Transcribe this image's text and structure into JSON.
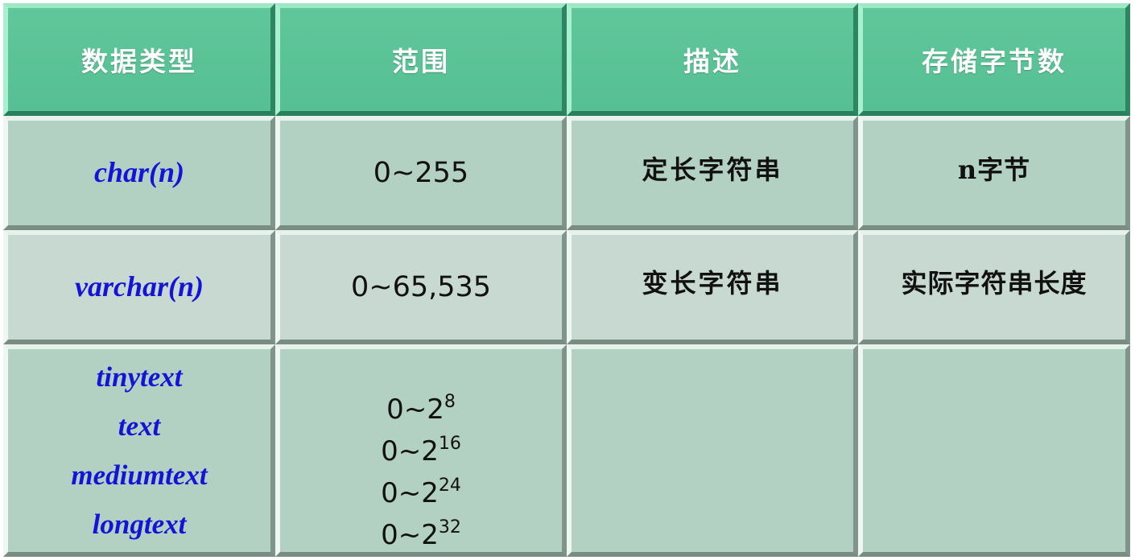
{
  "headers": [
    "数据类型",
    "范围",
    "描述",
    "存储字节数"
  ],
  "rows": [
    {
      "type": "char(n)",
      "range": "0~255",
      "description": "定长字符串",
      "bytes": "n字节"
    },
    {
      "type": "varchar(n)",
      "range": "0~65,535",
      "description": "变长字符串",
      "bytes": "实际字符串长度"
    }
  ],
  "text_types": [
    "tinytext",
    "text",
    "mediumtext",
    "longtext"
  ],
  "text_ranges": [
    {
      "base": "0~2",
      "exp": "8"
    },
    {
      "base": "0~2",
      "exp": "16"
    },
    {
      "base": "0~2",
      "exp": "24"
    },
    {
      "base": "0~2",
      "exp": "32"
    }
  ],
  "colors": {
    "header_bg": "#5bc396",
    "odd_row_bg": "#b3d1c2",
    "even_row_bg": "#c8d9d1",
    "type_text": "#1414d9"
  }
}
